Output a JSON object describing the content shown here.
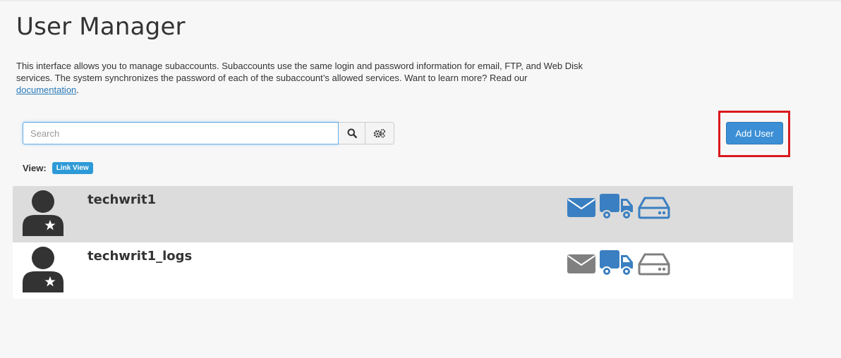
{
  "page": {
    "title": "User Manager",
    "description": "This interface allows you to manage subaccounts. Subaccounts use the same login and password information for email, FTP, and Web Disk services. The system synchronizes the password of each of the subaccount’s allowed services. Want to learn more? Read our",
    "doc_link": "documentation",
    "doc_suffix": "."
  },
  "search": {
    "placeholder": "Search"
  },
  "toolbar": {
    "add_user_label": "Add User"
  },
  "view": {
    "label": "View:",
    "mode": "Link View"
  },
  "colors": {
    "accent": "#3c8fd5",
    "service_enabled": "#3a7fc1",
    "service_disabled": "#808080",
    "highlight_box": "#d9191f"
  },
  "users": [
    {
      "name": "techwrit1",
      "services": {
        "email": "enabled",
        "ftp": "enabled",
        "webdisk": "enabled"
      }
    },
    {
      "name": "techwrit1_logs",
      "services": {
        "email": "disabled",
        "ftp": "enabled",
        "webdisk": "disabled"
      }
    }
  ]
}
